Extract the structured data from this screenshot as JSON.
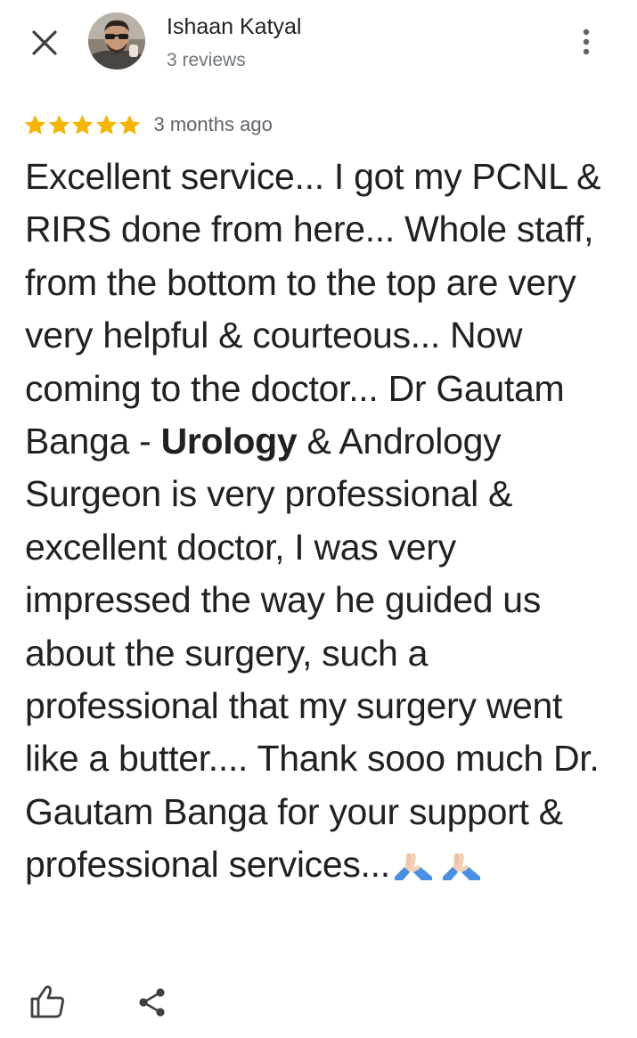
{
  "header": {
    "author_name": "Ishaan Katyal",
    "review_count": "3 reviews",
    "icons": {
      "close": "close-icon",
      "more": "more-vert-icon",
      "avatar": "profile-photo"
    }
  },
  "rating": {
    "stars": 5,
    "max_stars": 5,
    "star_color": "#f4b400",
    "time_ago": "3 months ago"
  },
  "review": {
    "text_before_bold": "Excellent service... I got my PCNL & RIRS done from here... Whole staff, from the bottom to the top are very very helpful & courteous... Now coming to the doctor... Dr Gautam Banga - ",
    "bold_term": "Urology",
    "text_after_bold": " & Andrology Surgeon is very professional & excellent doctor, I was very impressed the way he guided us about the surgery, such a professional that my surgery went like a butter.... Thank sooo much Dr.  Gautam Banga for your support & professional services...",
    "emoji": "folded-hands-emoji x2"
  },
  "actions": {
    "like_icon": "thumbs-up-icon",
    "share_icon": "share-icon"
  }
}
